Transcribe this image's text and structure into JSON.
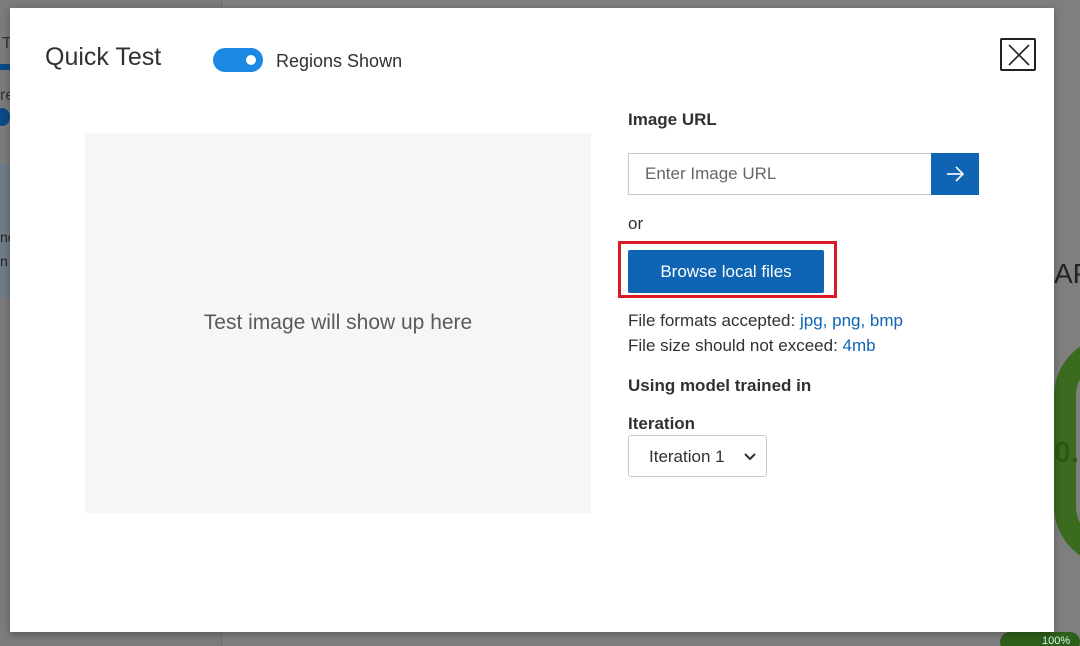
{
  "background": {
    "left_tab_text": "T",
    "left_text_re": "re",
    "left_text_1": "nc",
    "left_text_2": "n",
    "right_text_ap": "AP",
    "right_number": "0.",
    "progress_text": "100%"
  },
  "dialog": {
    "title": "Quick Test",
    "regions_toggle": {
      "label": "Regions Shown",
      "on": true
    },
    "close_icon": "close-icon",
    "preview": {
      "placeholder": "Test image will show up here"
    },
    "image_url": {
      "label": "Image URL",
      "placeholder": "Enter Image URL",
      "value": "",
      "submit_icon": "arrow-right-icon"
    },
    "or_text": "or",
    "browse_button": "Browse local files",
    "file_formats": {
      "label": "File formats accepted:",
      "value": "jpg, png, bmp"
    },
    "file_size": {
      "label": "File size should not exceed:",
      "value": "4mb"
    },
    "model_label": "Using model trained in",
    "iteration": {
      "label": "Iteration",
      "selected": "Iteration 1"
    }
  },
  "colors": {
    "accent": "#0f64b3",
    "toggle": "#1e88e5",
    "highlight": "#d81b22"
  }
}
